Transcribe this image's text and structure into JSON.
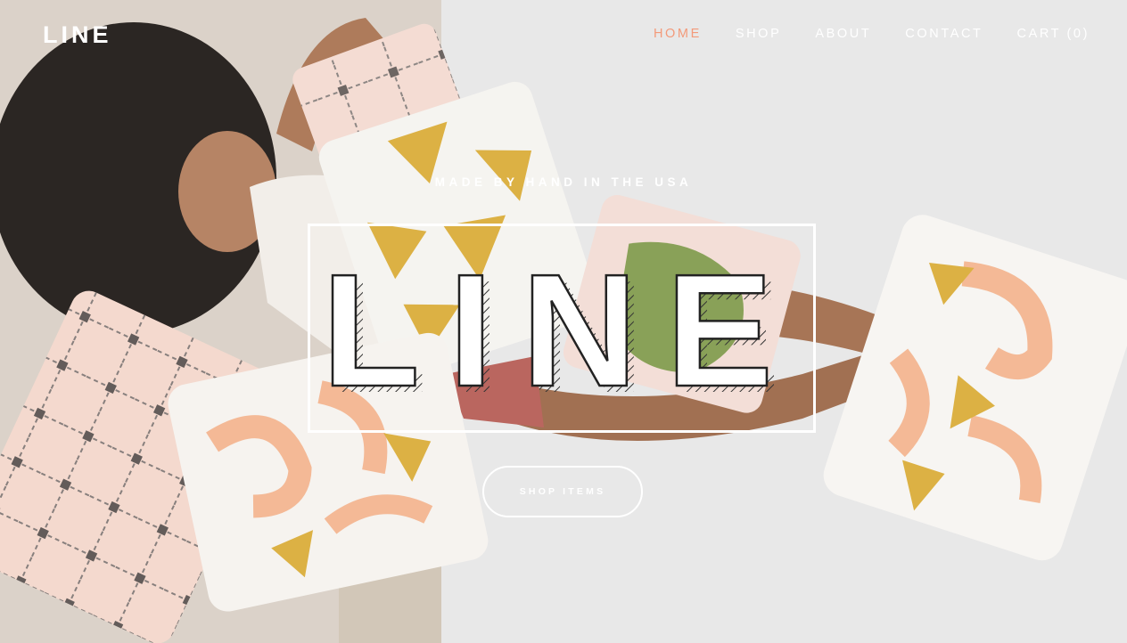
{
  "nav": {
    "logo": "LINE",
    "items": [
      {
        "label": "HOME",
        "active": true
      },
      {
        "label": "SHOP",
        "active": false
      },
      {
        "label": "ABOUT",
        "active": false
      },
      {
        "label": "CONTACT",
        "active": false
      },
      {
        "label": "CART (0)",
        "active": false
      }
    ]
  },
  "hero": {
    "tagline": "MADE BY HAND IN THE USA",
    "title": "LINE",
    "cta_label": "SHOP ITEMS",
    "image_subject": "woman lying among handmade printed pillows"
  },
  "colors": {
    "active_nav": "#f39a7a",
    "text": "#ffffff",
    "pillow_mustard": "#d9ab35",
    "pillow_peach": "#f3b48e",
    "pillow_pink": "#f3d9d0"
  }
}
